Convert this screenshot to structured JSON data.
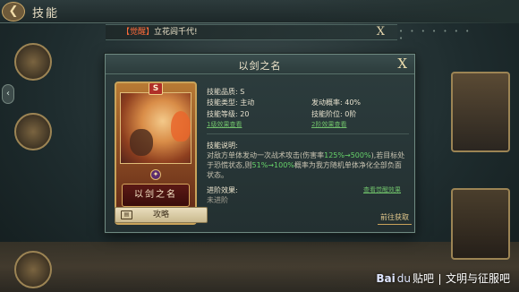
{
  "topbar": {
    "title": "技能"
  },
  "banner": {
    "tag": "【觉醒】",
    "text": "立花闾千代!"
  },
  "dialog": {
    "title": "以剑之名",
    "card": {
      "grade": "S",
      "name": "以剑之名"
    },
    "guide_label": "攻略",
    "quality": {
      "label": "技能品质:",
      "value": "S"
    },
    "type": {
      "label": "技能类型:",
      "value": "主动"
    },
    "level": {
      "label": "技能等级:",
      "value": "20"
    },
    "level_link": "1级效果查看",
    "prob": {
      "label": "发动概率:",
      "value": "40%"
    },
    "stage": {
      "label": "技能阶位:",
      "value": "0阶"
    },
    "stage_link": "2阶效果查看",
    "desc_title": "技能说明:",
    "desc": {
      "p1": "对敌方单体发动一次战术攻击(伤害率",
      "h1": "125%→500%",
      "p2": "),若目标处于恐慌状态,则",
      "h2": "51%→100%",
      "p3": "概率为我方随机单体净化全部负面状态。"
    },
    "adv_title": "进阶效果:",
    "adv_value": "未进阶",
    "view_awaken": "查看觉醒效果",
    "get_label": "前往获取"
  },
  "watermark": {
    "logo": "Bai",
    "paw": "du",
    "tieba": "贴吧",
    "forum": "文明与征服吧"
  }
}
